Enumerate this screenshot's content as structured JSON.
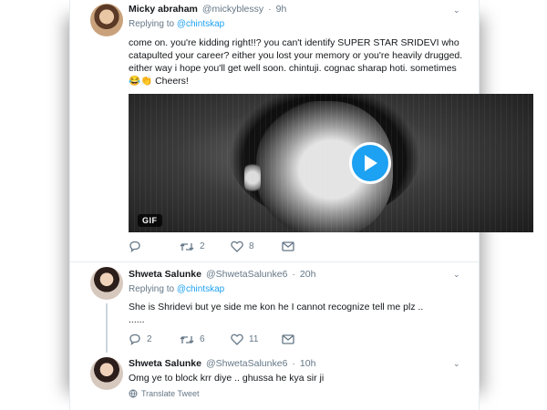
{
  "tweets": [
    {
      "name": "Micky abraham",
      "handle": "@mickyblessy",
      "time": "9h",
      "replying_label": "Replying to",
      "replying_to": "@chintskap",
      "text_lines": [
        "come on. you're kidding right!!? you can't identify SUPER STAR SRIDEVI who",
        "catapulted your career? either you lost your memory or you're heavily drugged.",
        "either way i hope you'll get well soon. chintuji. cognac sharap hoti. sometimes",
        "Cheers!"
      ],
      "emoji": "😂👏",
      "media_badge": "GIF",
      "actions": {
        "reply": "",
        "retweet": "2",
        "like": "8"
      }
    },
    {
      "name": "Shweta Salunke",
      "handle": "@ShwetaSalunke6",
      "time": "20h",
      "replying_label": "Replying to",
      "replying_to": "@chintskap",
      "text_lines": [
        "She is Shridevi but ye side me kon he I cannot recognize tell me plz ..",
        "......"
      ],
      "actions": {
        "reply": "2",
        "retweet": "6",
        "like": "11"
      }
    },
    {
      "name": "Shweta Salunke",
      "handle": "@ShwetaSalunke6",
      "time": "10h",
      "text_lines": [
        "Omg ye to block krr diye  .. ghussa he kya sir ji"
      ],
      "translate": "Translate Tweet"
    }
  ],
  "icons": {
    "reply": "reply-icon",
    "retweet": "retweet-icon",
    "like": "heart-icon",
    "dm": "mail-icon",
    "caret": "chevron-down-icon",
    "globe": "globe-icon",
    "play": "play-icon"
  },
  "colors": {
    "accent": "#1da1f2",
    "muted": "#657786",
    "text": "#14171a"
  }
}
